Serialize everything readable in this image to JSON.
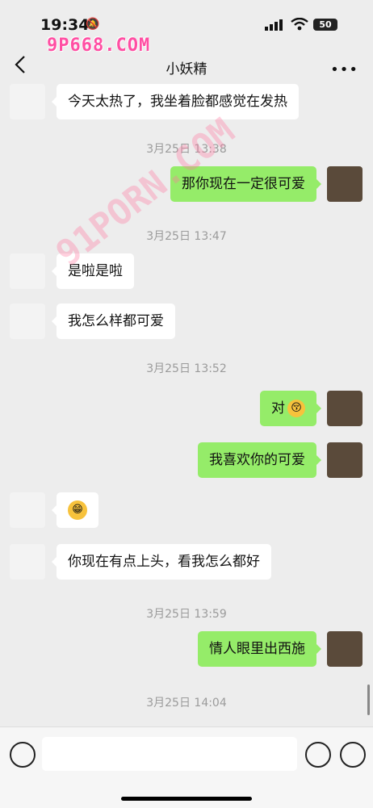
{
  "status": {
    "time": "19:34",
    "battery": "50",
    "watermark": "9P668.COM"
  },
  "nav": {
    "title": "小妖精"
  },
  "watermark_diag": "91PORN.COM",
  "messages": [
    {
      "type": "msg",
      "side": "left",
      "text": "今天太热了，我坐着脸都感觉在发热"
    },
    {
      "type": "time",
      "text": "3月25日 13:38"
    },
    {
      "type": "msg",
      "side": "right",
      "text": "那你现在一定很可爱"
    },
    {
      "type": "time",
      "text": "3月25日 13:47"
    },
    {
      "type": "msg",
      "side": "left",
      "text": "是啦是啦"
    },
    {
      "type": "msg",
      "side": "left",
      "text": "我怎么样都可爱"
    },
    {
      "type": "time",
      "text": "3月25日 13:52"
    },
    {
      "type": "msg",
      "side": "right",
      "text": "对",
      "emoji": "kissing-face"
    },
    {
      "type": "msg",
      "side": "right",
      "text": "我喜欢你的可爱"
    },
    {
      "type": "msg",
      "side": "left",
      "text": "",
      "emoji": "grinning-face"
    },
    {
      "type": "msg",
      "side": "left",
      "text": "你现在有点上头，看我怎么都好"
    },
    {
      "type": "time",
      "text": "3月25日 13:59"
    },
    {
      "type": "msg",
      "side": "right",
      "text": "情人眼里出西施"
    },
    {
      "type": "time",
      "text": "3月25日 14:04"
    }
  ]
}
